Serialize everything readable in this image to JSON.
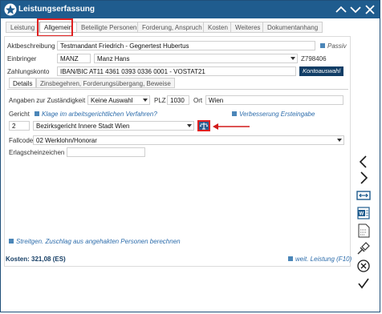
{
  "window": {
    "title": "Leistungserfassung"
  },
  "tabs": [
    {
      "label": "Leistung"
    },
    {
      "label": "Allgemein"
    },
    {
      "label": "Beteiligte Personen"
    },
    {
      "label": "Forderung, Anspruch"
    },
    {
      "label": "Kosten"
    },
    {
      "label": "Weiteres"
    },
    {
      "label": "Dokumentanhang"
    }
  ],
  "form": {
    "aktbeschreibung_label": "Aktbeschreibung",
    "aktbeschreibung_value": "Testmandant Friedrich - Gegnertest Hubertus",
    "passiv_label": "Passiv",
    "einbringer_label": "Einbringer",
    "einbringer_code": "MANZ",
    "einbringer_name": "Manz Hans",
    "einbringer_id": "Z798406",
    "zahlungskonto_label": "Zahlungskonto",
    "zahlungskonto_value": "IBAN/BIC AT11 4361 0393 0336 0001 - VOSTAT21",
    "kontoauswahl_label": "Kontoauswahl"
  },
  "subtabs": [
    {
      "label": "Details"
    },
    {
      "label": "Zinsbegehren, Forderungsübergang, Beweise"
    }
  ],
  "details": {
    "zustaendigkeit_label": "Angaben zur Zuständigkeit",
    "zustaendigkeit_value": "Keine Auswahl",
    "plz_label": "PLZ",
    "plz_value": "1030",
    "ort_label": "Ort",
    "ort_value": "Wien",
    "gericht_label": "Gericht",
    "klage_label": "Klage im arbeitsgerichtlichen Verfahren?",
    "verbesserung_label": "Verbesserung Ersteingabe",
    "gericht_nr": "2",
    "gericht_value": "Bezirksgericht Innere Stadt Wien",
    "fallcode_label": "Fallcode",
    "fallcode_value": "02 Werklohn/Honorar",
    "erlagschein_label": "Erlagscheinzeichen",
    "erlagschein_value": "",
    "streitgen_label": "Streitgen. Zuschlag aus angehakten Personen berechnen"
  },
  "footer": {
    "kosten_label": "Kosten: 321,08 (ES)",
    "weit_leistung_label": "weit. Leistung (F10)"
  },
  "colors": {
    "titlebar": "#1f5c8e",
    "accent": "#4b86b8",
    "highlight": "#e02020"
  }
}
